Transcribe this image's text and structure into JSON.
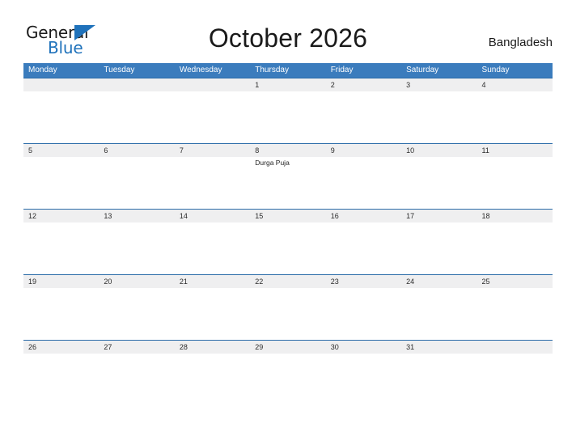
{
  "brand": {
    "name_part1": "General",
    "name_part2": "Blue",
    "accent_color": "#1f72bb"
  },
  "header": {
    "title": "October 2026",
    "country": "Bangladesh"
  },
  "calendar": {
    "header_bg": "#3b7cbd",
    "row_divider_color": "#2b6ca8",
    "date_strip_bg": "#efeff0",
    "weekdays": [
      "Monday",
      "Tuesday",
      "Wednesday",
      "Thursday",
      "Friday",
      "Saturday",
      "Sunday"
    ],
    "weeks": [
      {
        "days": [
          {
            "date": "",
            "event": ""
          },
          {
            "date": "",
            "event": ""
          },
          {
            "date": "",
            "event": ""
          },
          {
            "date": "1",
            "event": ""
          },
          {
            "date": "2",
            "event": ""
          },
          {
            "date": "3",
            "event": ""
          },
          {
            "date": "4",
            "event": ""
          }
        ]
      },
      {
        "days": [
          {
            "date": "5",
            "event": ""
          },
          {
            "date": "6",
            "event": ""
          },
          {
            "date": "7",
            "event": ""
          },
          {
            "date": "8",
            "event": "Durga Puja"
          },
          {
            "date": "9",
            "event": ""
          },
          {
            "date": "10",
            "event": ""
          },
          {
            "date": "11",
            "event": ""
          }
        ]
      },
      {
        "days": [
          {
            "date": "12",
            "event": ""
          },
          {
            "date": "13",
            "event": ""
          },
          {
            "date": "14",
            "event": ""
          },
          {
            "date": "15",
            "event": ""
          },
          {
            "date": "16",
            "event": ""
          },
          {
            "date": "17",
            "event": ""
          },
          {
            "date": "18",
            "event": ""
          }
        ]
      },
      {
        "days": [
          {
            "date": "19",
            "event": ""
          },
          {
            "date": "20",
            "event": ""
          },
          {
            "date": "21",
            "event": ""
          },
          {
            "date": "22",
            "event": ""
          },
          {
            "date": "23",
            "event": ""
          },
          {
            "date": "24",
            "event": ""
          },
          {
            "date": "25",
            "event": ""
          }
        ]
      },
      {
        "days": [
          {
            "date": "26",
            "event": ""
          },
          {
            "date": "27",
            "event": ""
          },
          {
            "date": "28",
            "event": ""
          },
          {
            "date": "29",
            "event": ""
          },
          {
            "date": "30",
            "event": ""
          },
          {
            "date": "31",
            "event": ""
          },
          {
            "date": "",
            "event": ""
          }
        ]
      }
    ]
  }
}
